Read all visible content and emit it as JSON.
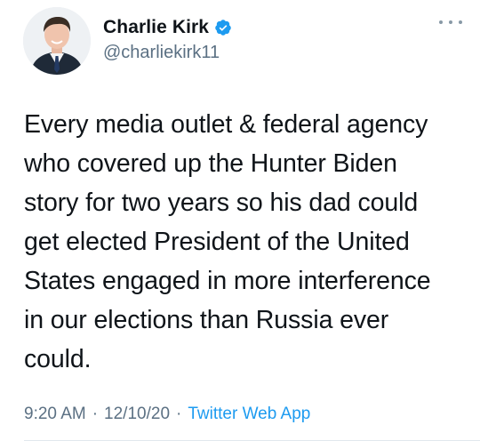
{
  "author": {
    "display_name": "Charlie Kirk",
    "handle": "@charliekirk11",
    "verified_icon": "verified-badge-icon",
    "avatar_icon": "profile-avatar"
  },
  "tweet": {
    "text": "Every media outlet & federal agency\nwho covered up the Hunter Biden\nstory for two years so his dad could\nget elected President of the United\nStates engaged in more interference\nin our elections than Russia ever\ncould.",
    "time": "9:20 AM",
    "date": "12/10/20",
    "separator": "·",
    "source": "Twitter Web App"
  },
  "colors": {
    "text": "#0f1419",
    "secondary": "#5b7083",
    "link": "#1d9bf0",
    "verified": "#1d9bf0"
  },
  "icons": {
    "more": "more-options-icon"
  }
}
